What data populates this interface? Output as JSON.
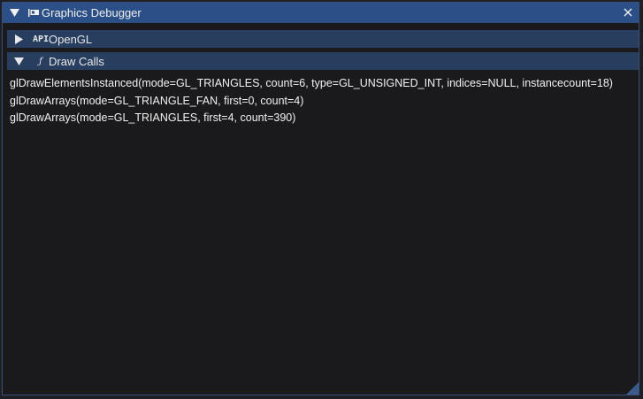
{
  "window": {
    "title": "Graphics Debugger",
    "icons": {
      "collapse": "triangle-down-icon",
      "app": "display-card-icon",
      "close": "close-icon"
    }
  },
  "sections": [
    {
      "label": "OpenGL",
      "icon": "API",
      "expanded": false
    },
    {
      "label": "Draw Calls",
      "icon": "ƒ",
      "expanded": true
    }
  ],
  "draw_calls": [
    "glDrawElementsInstanced(mode=GL_TRIANGLES, count=6, type=GL_UNSIGNED_INT, indices=NULL, instancecount=18)",
    "glDrawArrays(mode=GL_TRIANGLE_FAN, first=0, count=4)",
    "glDrawArrays(mode=GL_TRIANGLES, first=4, count=390)"
  ],
  "colors": {
    "titlebar": "#2b4f87",
    "section_header": "#273e5f",
    "window_bg": "#1a1a1c",
    "text": "#f2f2f2",
    "resize_grip": "#3a5a8c"
  }
}
